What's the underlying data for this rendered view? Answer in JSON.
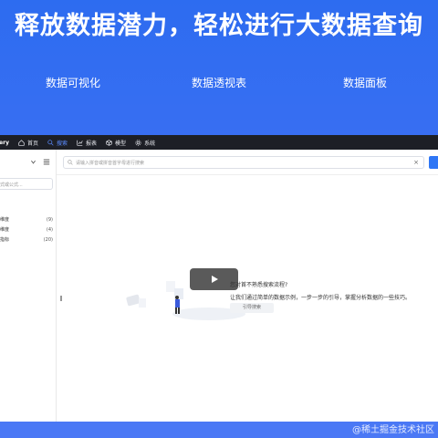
{
  "hero": {
    "title": "释放数据潜力，轻松进行大数据查询",
    "tabs": [
      "数据可视化",
      "数据透视表",
      "数据面板"
    ]
  },
  "app": {
    "brand": "ery",
    "nav": [
      {
        "label": "首页",
        "icon": "home-icon"
      },
      {
        "label": "搜索",
        "icon": "search-icon",
        "active": true
      },
      {
        "label": "报表",
        "icon": "chart-icon"
      },
      {
        "label": "模型",
        "icon": "cube-icon"
      },
      {
        "label": "系统",
        "icon": "gear-icon"
      }
    ]
  },
  "sidebar": {
    "search_placeholder": "式或公式...",
    "items": [
      {
        "label": "维度",
        "count": "(9)"
      },
      {
        "label": "维度",
        "count": "(4)"
      },
      {
        "label": "指标",
        "count": "(20)"
      }
    ]
  },
  "main": {
    "search_placeholder": "请输入拼音或拼音首字母进行搜索",
    "clear_label": "×",
    "empty_title": "您对首不熟悉搜索流程?",
    "empty_desc": "让我们通过简单的数据示例，一步一步的引导，掌握分析数据的一些技巧。",
    "guide_button": "引导搜索"
  },
  "watermark": "@稀土掘金技术社区",
  "colors": {
    "accent": "#2f76f5",
    "topbar": "#1d1f26"
  }
}
